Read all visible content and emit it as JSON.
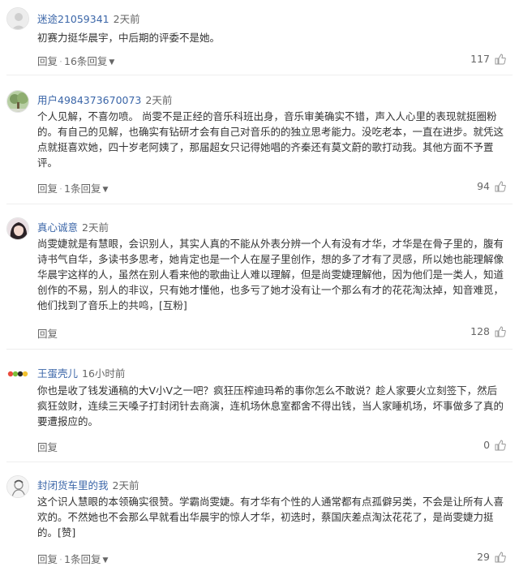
{
  "comments": [
    {
      "username": "迷途21059341",
      "time": "2天前",
      "text": "初赛力挺华晨宇，中后期的评委不是她。",
      "reply": "回复",
      "reply_count": "16条回复",
      "likes": "117",
      "avatar": "default-gray-avatar"
    },
    {
      "username": "用户4984373670073",
      "time": "2天前",
      "text": "个人见解，不喜勿喷。 尚雯不是正经的音乐科班出身，音乐审美确实不错，声入人心里的表现就挺圈粉的。有自己的见解，也确实有钻研才会有自己对音乐的的独立思考能力。没吃老本，一直在进步。就凭这点就挺喜欢她，四十岁老阿姨了，那届超女只记得她唱的齐秦还有莫文蔚的歌打动我。其他方面不予置评。",
      "reply": "回复",
      "reply_count": "1条回复",
      "likes": "94",
      "avatar": "landscape-avatar"
    },
    {
      "username": "真心诚意",
      "time": "2天前",
      "text": "尚雯婕就是有慧眼，会识别人，其实人真的不能从外表分辨一个人有没有才华，才华是在骨子里的，腹有诗书气自华，多读书多思考，她肯定也是一个人在屋子里创作，想的多了才有了灵感，所以她也能理解像华晨宇这样的人，虽然在别人看来他的歌曲让人难以理解，但是尚雯婕理解他，因为他们是一类人，知道创作的不易，别人的非议，只有她才懂他，也多亏了她才没有让一个那么有才的花花淘汰掉，知音难觅，他们找到了音乐上的共鸣，[互粉]",
      "reply": "回复",
      "reply_count": "",
      "likes": "128",
      "avatar": "girl-avatar"
    },
    {
      "username": "王蛋壳儿",
      "time": "16小时前",
      "text": "你也是收了钱发通稿的大V小V之一吧？疯狂压榨迪玛希的事你怎么不敢说？趁人家要火立刻签下，然后疯狂敛财，连续三天嗓子打封闭针去商演，连机场休息室都舍不得出钱，当人家睡机场，坏事做多了真的要遭报应的。",
      "reply": "回复",
      "reply_count": "",
      "likes": "0",
      "avatar": "colorful-dots-avatar"
    },
    {
      "username": "封闭货车里的我",
      "time": "2天前",
      "text": "这个识人慧眼的本领确实很赞。学霸尚雯婕。有才华有个性的人通常都有点孤僻另类，不会是让所有人喜欢的。不然她也不会那么早就看出华晨宇的惊人才华，初选时，蔡国庆差点淘汰花花了，是尚雯婕力挺的。[赞]",
      "reply": "回复",
      "reply_count": "1条回复",
      "likes": "29",
      "avatar": "sketch-avatar"
    }
  ],
  "colors": {
    "username": "#3b66a8",
    "text": "#333333",
    "muted": "#666666"
  }
}
